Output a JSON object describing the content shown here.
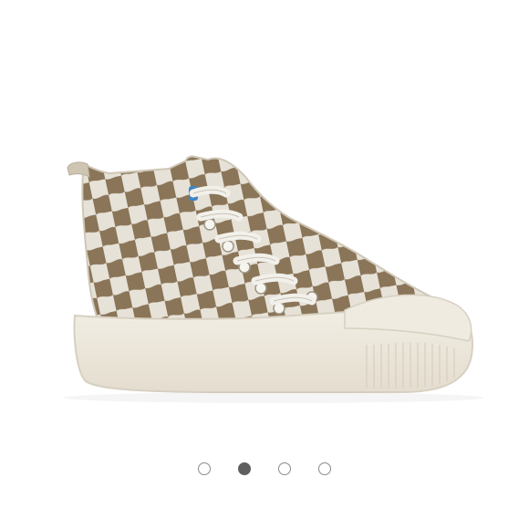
{
  "product": {
    "image_icon": "checkered-high-top-sneaker",
    "colors": {
      "canvas_light": "#e7e2d8",
      "canvas_dark": "#8a7558",
      "sole": "#efebe0",
      "lace": "#f2f0ea",
      "tab": "#3d86c6"
    }
  },
  "carousel": {
    "total_slides": 4,
    "current_slide": 2,
    "colors": {
      "active": "#5f5f5f",
      "inactive_border": "#8a8a8a"
    }
  }
}
